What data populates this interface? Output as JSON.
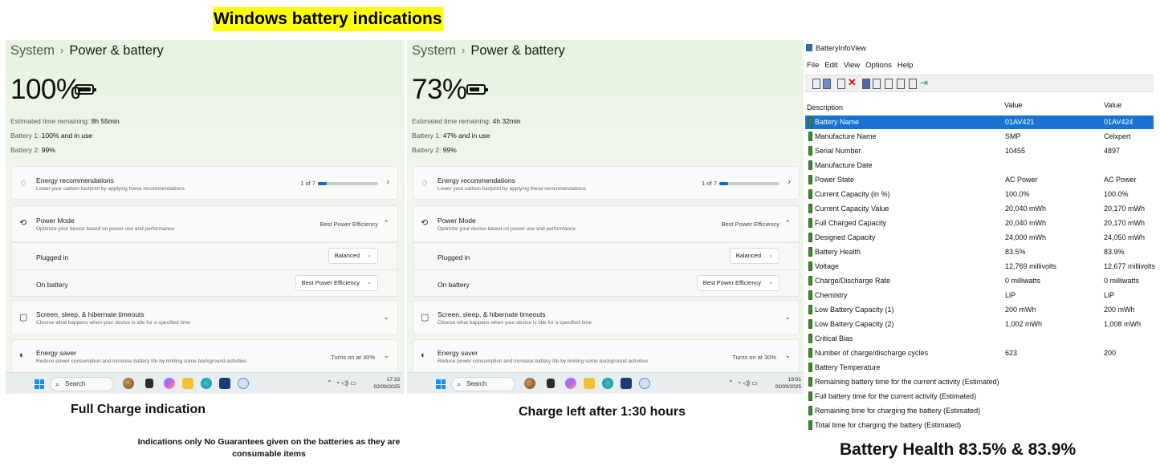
{
  "title": "Windows battery indications",
  "panels": [
    {
      "breadcrumb_root": "System",
      "breadcrumb_sep": "›",
      "breadcrumb_page": "Power & battery",
      "percent": "100%",
      "battery_level": 1.0,
      "est_label": "Estimated time remaining:",
      "est_value": "8h 55min",
      "battery1_label": "Battery 1:",
      "battery1_value": "100% and in use",
      "battery2_label": "Battery 2:",
      "battery2_value": "99%",
      "energy_title": "Energy recommendations",
      "energy_desc": "Lower your carbon footprint by applying these recommendations",
      "energy_count": "1 of 7",
      "energy_progress": 0.14,
      "power_mode_title": "Power Mode",
      "power_mode_desc": "Optimize your device based on power use and performance",
      "power_mode_value": "Best Power Efficiency",
      "plugged_in_label": "Plugged in",
      "plugged_in_value": "Balanced",
      "on_battery_label": "On battery",
      "on_battery_value": "Best Power Efficiency",
      "screen_title": "Screen, sleep, & hibernate timeouts",
      "screen_desc": "Choose what happens when your device is idle for a specified time",
      "saver_title": "Energy saver",
      "saver_desc": "Reduce power consumption and increase battery life by limiting some background activities",
      "saver_value": "Turns on at 30%",
      "search_label": "Search",
      "time": "17:33",
      "date": "02/09/2025"
    },
    {
      "breadcrumb_root": "System",
      "breadcrumb_sep": "›",
      "breadcrumb_page": "Power & battery",
      "percent": "73%",
      "battery_level": 0.73,
      "est_label": "Estimated time remaining:",
      "est_value": "4h 32min",
      "battery1_label": "Battery 1:",
      "battery1_value": "47% and in use",
      "battery2_label": "Battery 2:",
      "battery2_value": "99%",
      "energy_title": "Energy recommendations",
      "energy_desc": "Lower your carbon footprint by applying these recommendations",
      "energy_count": "1 of 7",
      "energy_progress": 0.14,
      "power_mode_title": "Power Mode",
      "power_mode_desc": "Optimize your device based on power use and performance",
      "power_mode_value": "Best Power Efficiency",
      "plugged_in_label": "Plugged in",
      "plugged_in_value": "Balanced",
      "on_battery_label": "On battery",
      "on_battery_value": "Best Power Efficiency",
      "screen_title": "Screen, sleep, & hibernate timeouts",
      "screen_desc": "Choose what happens when your device is idle for a specified time",
      "saver_title": "Energy saver",
      "saver_desc": "Reduce power consumption and increase battery life by limiting some background activities",
      "saver_value": "Turns on at 30%",
      "search_label": "Search",
      "time": "19:01",
      "date": "02/09/2025"
    }
  ],
  "captions": {
    "full_charge": "Full Charge indication",
    "charge_left": "Charge left after 1:30 hours",
    "disclaimer_line1": "Indications only No Guarantees given on the batteries as they are",
    "disclaimer_line2": "consumable items",
    "battery_health": "Battery Health 83.5% & 83.9%"
  },
  "batteryinfoview": {
    "window_title": "BatteryInfoView",
    "menu": [
      "File",
      "Edit",
      "View",
      "Options",
      "Help"
    ],
    "columns": [
      "Description",
      "Value",
      "Value"
    ],
    "sort_indicator": "/",
    "rows": [
      [
        "Battery Name",
        "01AV421",
        "01AV424"
      ],
      [
        "Manufacture Name",
        "SMP",
        "Celxpert"
      ],
      [
        "Serial Number",
        "10455",
        "4897"
      ],
      [
        "Manufacture Date",
        "",
        ""
      ],
      [
        "Power State",
        "AC Power",
        "AC Power"
      ],
      [
        "Current Capacity (in %)",
        "100.0%",
        "100.0%"
      ],
      [
        "Current Capacity Value",
        "20,040 mWh",
        "20,170 mWh"
      ],
      [
        "Full Charged Capacity",
        "20,040 mWh",
        "20,170 mWh"
      ],
      [
        "Designed Capacity",
        "24,000 mWh",
        "24,050 mWh"
      ],
      [
        "Battery Health",
        "83.5%",
        "83.9%"
      ],
      [
        "Voltage",
        "12,769 millivolts",
        "12,677 millivolts"
      ],
      [
        "Charge/Discharge Rate",
        "0 milliwatts",
        "0 milliwatts"
      ],
      [
        "Chemistry",
        "LiP",
        "LiP"
      ],
      [
        "Low Battery Capacity (1)",
        "200 mWh",
        "200 mWh"
      ],
      [
        "Low Battery Capacity (2)",
        "1,002 mWh",
        "1,008 mWh"
      ],
      [
        "Critical Bias",
        "",
        ""
      ],
      [
        "Number of charge/discharge cycles",
        "623",
        "200"
      ],
      [
        "Battery Temperature",
        "",
        ""
      ],
      [
        "Remaining battery time for the current activity (Estimated)",
        "",
        ""
      ],
      [
        "Full battery time for the current activity (Estimated)",
        "",
        ""
      ],
      [
        "Remaining time for charging the battery (Estimated)",
        "",
        ""
      ],
      [
        "Total  time for charging the battery (Estimated)",
        "",
        ""
      ]
    ]
  },
  "colors": {
    "highlight": "#ffff00",
    "selection": "#1873d3",
    "accent": "#0f6cbd",
    "battery_icon": "#3b8a2c"
  }
}
